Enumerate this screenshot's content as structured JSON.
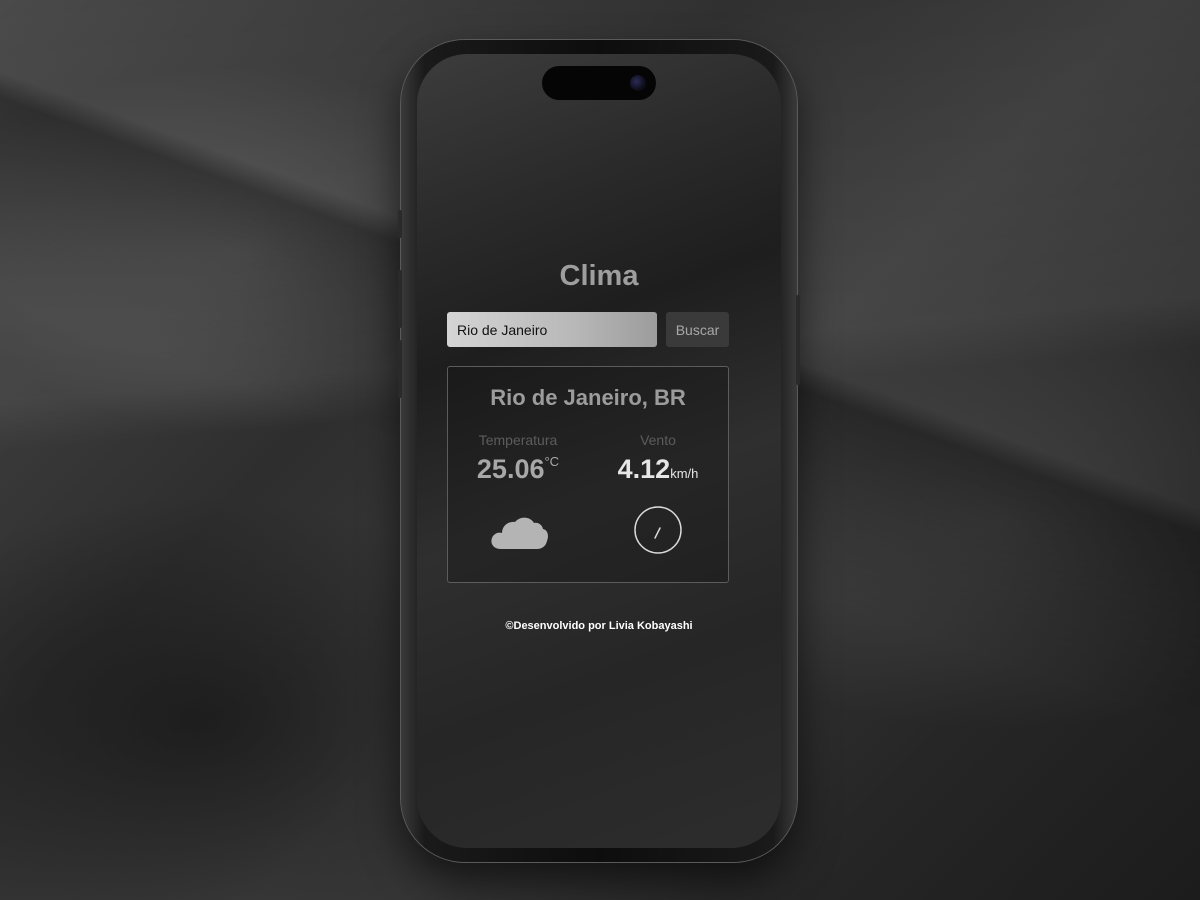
{
  "app": {
    "title": "Clima"
  },
  "search": {
    "value": "Rio de Janeiro",
    "button_label": "Buscar"
  },
  "weather": {
    "location": "Rio de Janeiro, BR",
    "temperature_label": "Temperatura",
    "temperature_value": "25.06",
    "temperature_unit": "°C",
    "wind_label": "Vento",
    "wind_value": "4.12",
    "wind_unit": "km/h",
    "condition_icon": "cloud-icon",
    "wind_icon": "wind-direction-dial-icon"
  },
  "footer": {
    "credit": "©Desenvolvido por Livia Kobayashi"
  },
  "colors": {
    "title": "#9e9e9e",
    "card_border": "#5c5c5c",
    "button_bg": "#3a3a3a",
    "footer_text": "#ffffff"
  }
}
